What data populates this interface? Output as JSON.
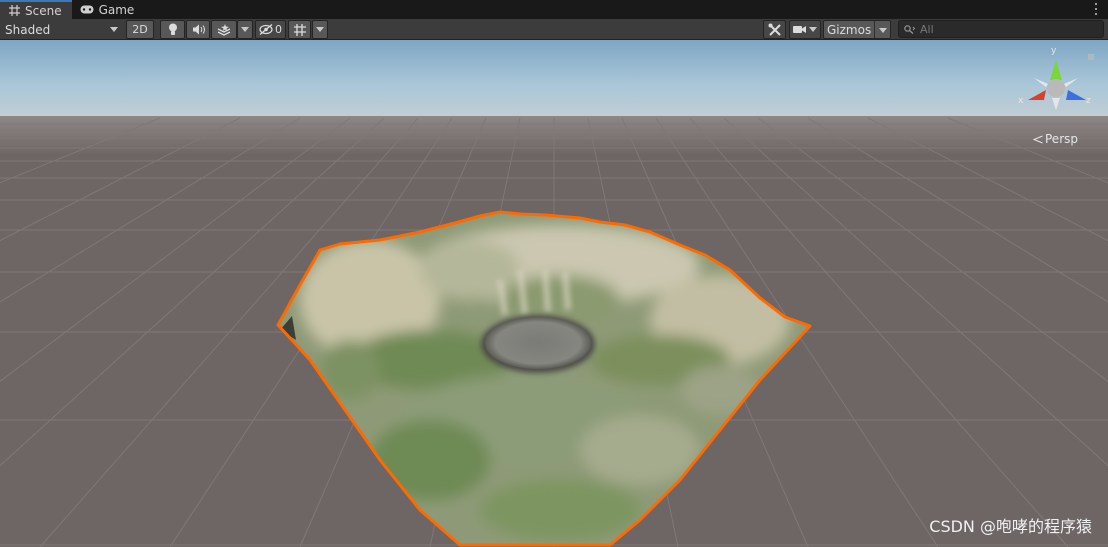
{
  "tabs": [
    {
      "label": "Scene",
      "icon": "grid-icon",
      "active": true
    },
    {
      "label": "Game",
      "icon": "gamepad-icon",
      "active": false
    }
  ],
  "toolbar": {
    "shading_mode": "Shaded",
    "two_d_label": "2D",
    "hidden_count": "0",
    "gizmos_label": "Gizmos",
    "search_placeholder": "All"
  },
  "viewport": {
    "projection_label": "Persp",
    "axis_x": "x",
    "axis_y": "y",
    "axis_z": "z",
    "watermark": "CSDN @咆哮的程序猿",
    "selection_color": "#ff6a00",
    "sky_color": "#a6c4d8",
    "ground_color": "#6d6665"
  }
}
